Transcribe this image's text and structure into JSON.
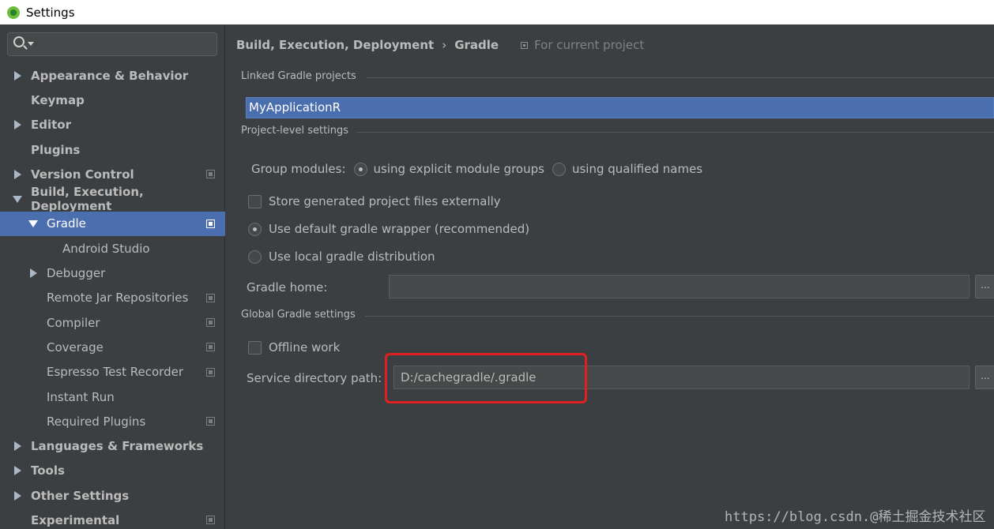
{
  "window": {
    "title": "Settings"
  },
  "search": {
    "placeholder": ""
  },
  "sidebar": {
    "items": [
      {
        "label": "Appearance & Behavior",
        "arrow": "right",
        "bold": true,
        "indent": 0,
        "copy_icon": false,
        "selected": false
      },
      {
        "label": "Keymap",
        "arrow": "none",
        "bold": true,
        "indent": 0,
        "copy_icon": false,
        "selected": false
      },
      {
        "label": "Editor",
        "arrow": "right",
        "bold": true,
        "indent": 0,
        "copy_icon": false,
        "selected": false
      },
      {
        "label": "Plugins",
        "arrow": "none",
        "bold": true,
        "indent": 0,
        "copy_icon": false,
        "selected": false
      },
      {
        "label": "Version Control",
        "arrow": "right",
        "bold": true,
        "indent": 0,
        "copy_icon": true,
        "selected": false
      },
      {
        "label": "Build, Execution, Deployment",
        "arrow": "down",
        "bold": true,
        "indent": 0,
        "copy_icon": false,
        "selected": false
      },
      {
        "label": "Gradle",
        "arrow": "down",
        "bold": false,
        "indent": 1,
        "copy_icon": true,
        "selected": true
      },
      {
        "label": "Android Studio",
        "arrow": "none",
        "bold": false,
        "indent": 2,
        "copy_icon": false,
        "selected": false
      },
      {
        "label": "Debugger",
        "arrow": "right",
        "bold": false,
        "indent": 1,
        "copy_icon": false,
        "selected": false
      },
      {
        "label": "Remote Jar Repositories",
        "arrow": "none",
        "bold": false,
        "indent": 1,
        "copy_icon": true,
        "selected": false
      },
      {
        "label": "Compiler",
        "arrow": "none",
        "bold": false,
        "indent": 1,
        "copy_icon": true,
        "selected": false
      },
      {
        "label": "Coverage",
        "arrow": "none",
        "bold": false,
        "indent": 1,
        "copy_icon": true,
        "selected": false
      },
      {
        "label": "Espresso Test Recorder",
        "arrow": "none",
        "bold": false,
        "indent": 1,
        "copy_icon": true,
        "selected": false
      },
      {
        "label": "Instant Run",
        "arrow": "none",
        "bold": false,
        "indent": 1,
        "copy_icon": false,
        "selected": false
      },
      {
        "label": "Required Plugins",
        "arrow": "none",
        "bold": false,
        "indent": 1,
        "copy_icon": true,
        "selected": false
      },
      {
        "label": "Languages & Frameworks",
        "arrow": "right",
        "bold": true,
        "indent": 0,
        "copy_icon": false,
        "selected": false
      },
      {
        "label": "Tools",
        "arrow": "right",
        "bold": true,
        "indent": 0,
        "copy_icon": false,
        "selected": false
      },
      {
        "label": "Other Settings",
        "arrow": "right",
        "bold": true,
        "indent": 0,
        "copy_icon": false,
        "selected": false
      },
      {
        "label": "Experimental",
        "arrow": "none",
        "bold": true,
        "indent": 0,
        "copy_icon": true,
        "selected": false
      }
    ]
  },
  "breadcrumb": {
    "parent": "Build, Execution, Deployment",
    "separator": "›",
    "current": "Gradle",
    "scope": "For current project"
  },
  "linked": {
    "title": "Linked Gradle projects",
    "project": "MyApplicationR"
  },
  "project_level": {
    "title": "Project-level settings",
    "group_modules_label": "Group modules:",
    "option_explicit": "using explicit module groups",
    "option_qualified": "using qualified names",
    "store_external": "Store generated project files externally",
    "use_wrapper": "Use default gradle wrapper (recommended)",
    "use_local": "Use local gradle distribution",
    "gradle_home_label": "Gradle home:",
    "gradle_home_value": "",
    "browse": "..."
  },
  "global": {
    "title": "Global Gradle settings",
    "offline_work": "Offline work",
    "service_dir_label": "Service directory path:",
    "service_dir_value": "D:/cachegradle/.gradle",
    "browse": "..."
  },
  "watermark": "https://blog.csdn.@稀土掘金技术社区",
  "colors": {
    "selection": "#4b6eaf",
    "background": "#3c3f41",
    "highlight": "#e02020"
  }
}
